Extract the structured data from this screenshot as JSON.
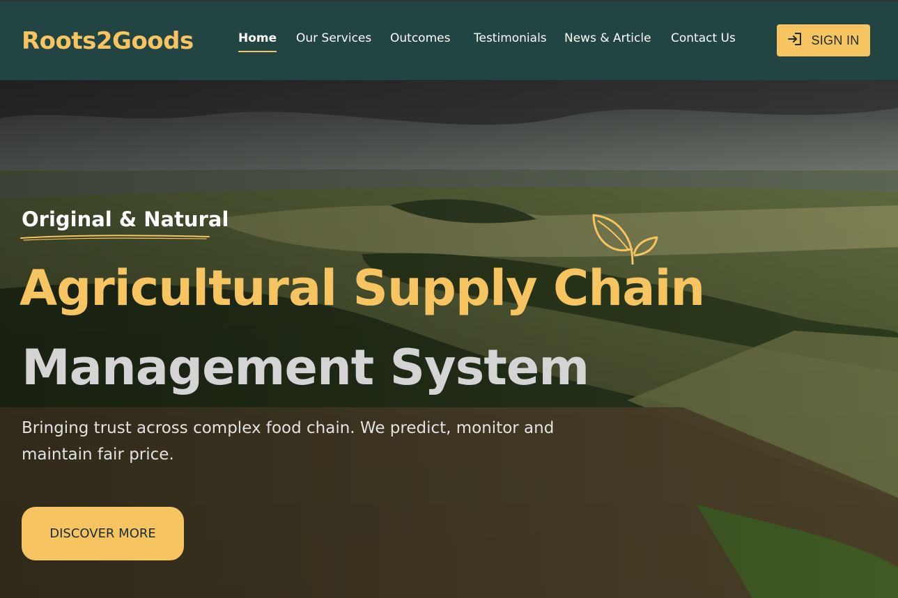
{
  "brand": {
    "name": "Roots2Goods",
    "accent": "#f6c460",
    "header_bg": "#224543"
  },
  "nav": {
    "items": [
      {
        "label": "Home",
        "active": true
      },
      {
        "label": "Our Services",
        "active": false
      },
      {
        "label": "Outcomes",
        "active": false
      },
      {
        "label": "Testimonials",
        "active": false
      },
      {
        "label": "News & Article",
        "active": false
      },
      {
        "label": "Contact Us",
        "active": false
      }
    ]
  },
  "signin": {
    "label": "SIGN IN",
    "icon": "login-icon"
  },
  "hero": {
    "tagline": "Original & Natural",
    "title_line1": "Agricultural Supply Chain",
    "title_line2": "Management System",
    "subtitle": "Bringing trust across complex food chain. We predict, monitor and maintain fair price.",
    "cta_label": "DISCOVER MORE",
    "decor_icon": "leaf-sprout-icon",
    "background": "aerial-farmland-photo"
  }
}
